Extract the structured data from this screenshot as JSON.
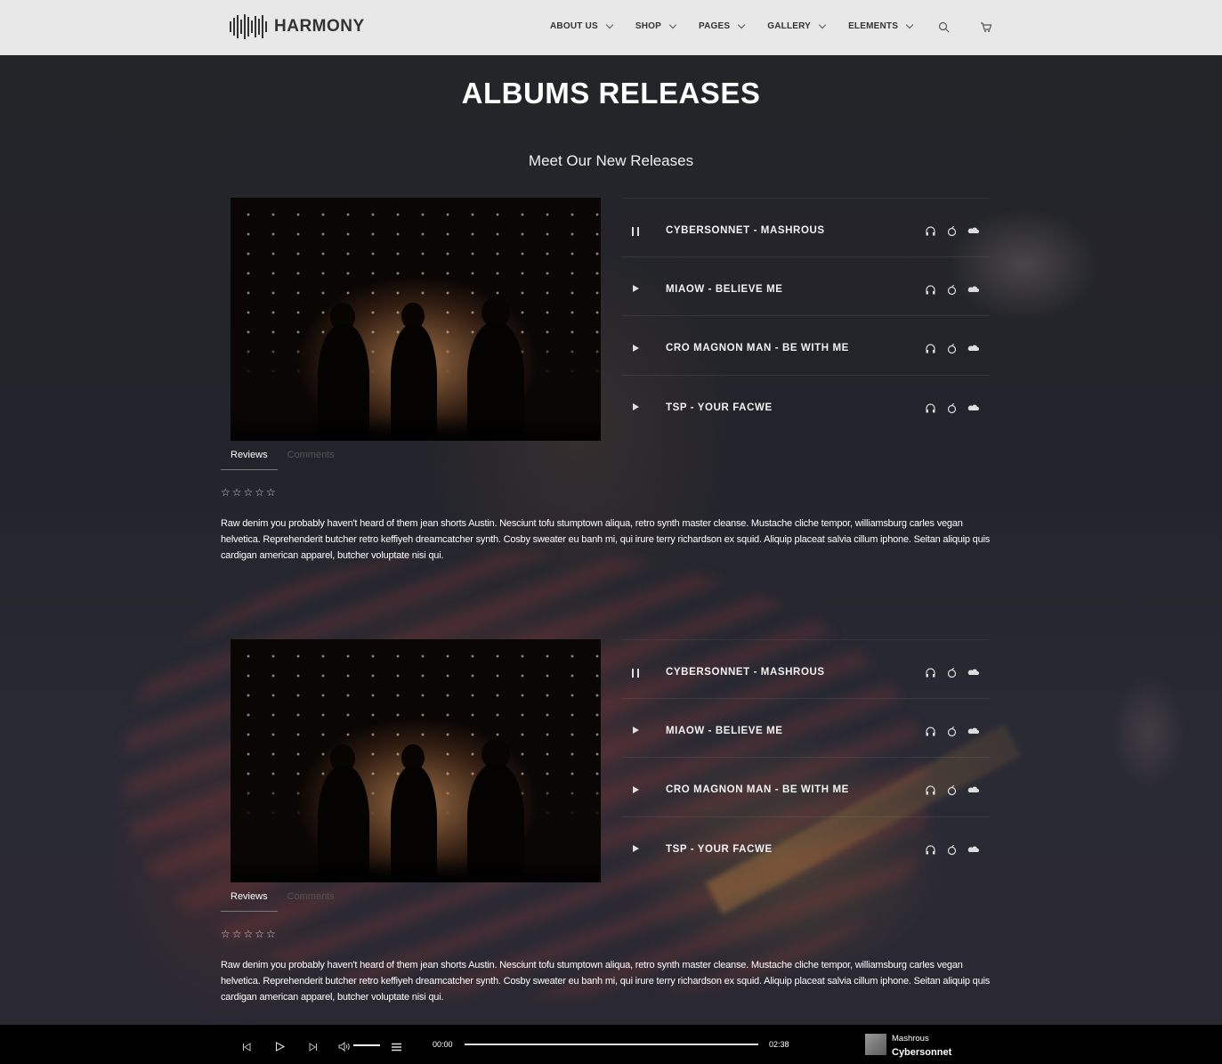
{
  "header": {
    "logo_text": "HARMONY",
    "nav": [
      {
        "label": "ABOUT US"
      },
      {
        "label": "SHOP"
      },
      {
        "label": "PAGES"
      },
      {
        "label": "GALLERY"
      },
      {
        "label": "ELEMENTS"
      }
    ],
    "icons": [
      "search-icon",
      "cart-icon"
    ]
  },
  "main": {
    "title": "ALBUMS RELEASES",
    "subtitle": "Meet Our New Releases",
    "albums": [
      {
        "tracks": [
          {
            "title": "CYBERSONNET - MASHROUS",
            "state": "playing"
          },
          {
            "title": "MIAOW - BELIEVE ME",
            "state": "paused"
          },
          {
            "title": "CRO MAGNON MAN - BE WITH ME",
            "state": "paused"
          },
          {
            "title": "TSP - YOUR FACWE",
            "state": "paused"
          }
        ],
        "tabs": [
          {
            "label": "Reviews",
            "active": true
          },
          {
            "label": "Comments",
            "active": false
          }
        ],
        "stars": "☆☆☆☆☆",
        "review": "Raw denim you probably haven't heard of them jean shorts Austin. Nesciunt tofu stumptown aliqua, retro synth master cleanse. Mustache cliche tempor, williamsburg carles vegan helvetica. Reprehenderit butcher retro keffiyeh dreamcatcher synth. Cosby sweater eu banh mi, qui irure terry richardson ex squid. Aliquip placeat salvia cillum iphone. Seitan aliquip quis cardigan american apparel, butcher voluptate nisi qui."
      },
      {
        "tracks": [
          {
            "title": "CYBERSONNET - MASHROUS",
            "state": "playing"
          },
          {
            "title": "MIAOW - BELIEVE ME",
            "state": "paused"
          },
          {
            "title": "CRO MAGNON MAN - BE WITH ME",
            "state": "paused"
          },
          {
            "title": "TSP - YOUR FACWE",
            "state": "paused"
          }
        ],
        "tabs": [
          {
            "label": "Reviews",
            "active": true
          },
          {
            "label": "Comments",
            "active": false
          }
        ],
        "stars": "☆☆☆☆☆",
        "review": "Raw denim you probably haven't heard of them jean shorts Austin. Nesciunt tofu stumptown aliqua, retro synth master cleanse. Mustache cliche tempor, williamsburg carles vegan helvetica. Reprehenderit butcher retro keffiyeh dreamcatcher synth. Cosby sweater eu banh mi, qui irure terry richardson ex squid. Aliquip placeat salvia cillum iphone. Seitan aliquip quis cardigan american apparel, butcher voluptate nisi qui."
      }
    ]
  },
  "player": {
    "current_time": "00:00",
    "duration": "02:38",
    "progress": 0,
    "now_playing_track": "Mashrous",
    "now_playing_artist": "Cybersonnet"
  }
}
